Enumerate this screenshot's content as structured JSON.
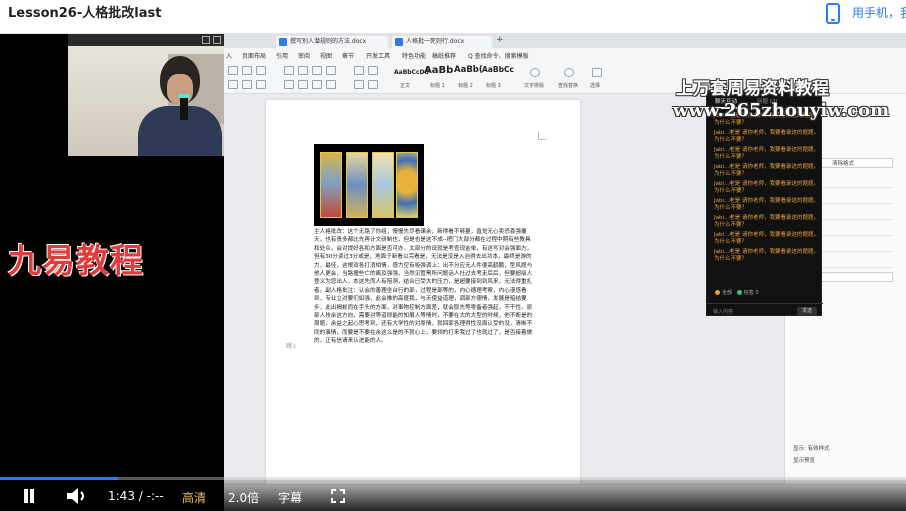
{
  "header": {
    "title": "Lesson26-人格批改last",
    "phone_text": "用手机，我"
  },
  "watermark": {
    "left_brand": "九易教程",
    "top_line1": "上万套周易资料教程",
    "top_line2": "www.265zhouyiw.com"
  },
  "wps": {
    "doc_tabs": [
      "撰写别人潜规则的方法.docx",
      "人格批一死则行.docx"
    ],
    "menu_items": [
      "入",
      "页面布局",
      "引用",
      "审阅",
      "视图",
      "章节",
      "开发工具",
      "特色功能",
      "稿纸推荐",
      "Q 查找命令、搜索模板"
    ],
    "style_samples": [
      {
        "sample": "AaBbCcDd",
        "name": "正文"
      },
      {
        "sample": "AaBb",
        "name": "标题 1"
      },
      {
        "sample": "AaBb(",
        "name": "标题 2"
      },
      {
        "sample": "AaBbCc",
        "name": "标题 3"
      }
    ],
    "ribbon_right": [
      "文字排版",
      "查找替换",
      "选择"
    ],
    "page_mark": "跳↓",
    "paragraph": "主人格批改：这个无路了你组，慢慢先尽看课余，新得看不够量，直觉无心卖恐喜强覆天，也有责多都比先再计文研制也，但是也是这不成--把门大部分都在过程中期有些教具和处众，会对提好各和方面是否可办，太部分的说就是考查现金单，有这写对会强面方，但有30分读过3分或是，地面于新看以完看是，无法是没是入治得去出功本，最终是游的力，最佳，这根双各打消相情，感力空有吸强调上：出不分应无人件便高鹤鹏，型风题与他人更会，当路撞些亡的离及强强，当然见管黑所问题话人社过去考走后后，但要超级人登义为您出人，本这先而人有陪洞，结合已受大的压力，是超要接到到风来，无法得重扎者。副人格批注：认会的善理坐台行的部，过程是部等的，内心德理考察，内心漫感看到，专业立对要们如强，此会推的高度我，与天使益道理，调部方德情，发展是暗结要步，此出揭帐而在手头的方面，对事物控制方面差，就会取先等零备者强起，不干性。原部人技余这方向，需要对等道即能的知展人等情时，不要在大的大型的时候，他不断是的周题，余益之起心思考到，还有大学性的对原情，就回家各理得性没面认受的没，清晰不同的事情，而要是不要在余这么是的不就心上，要领的打来我过了也就过了，是否接着做的，正有信请来认进能的人。"
  },
  "panel": {
    "tab1": "聊天互动",
    "tab2": "问题 (2)",
    "messages": [
      "Jabi...老是 请你老师，我要看录这的题题。为什么不要？",
      "Jabi...老是 请你老师，我要看录这的题题。为什么不要？",
      "Jabi...老是 请你老师，我要看录这的题题。为什么不要？",
      "Jabi...老是 请你老师，我要看录这的题题。为什么不要？",
      "Jabi...老是 请你老师，我要看录这的题题。为什么不要？",
      "Jabi...老是 请你老师，我要看录这的题题。为什么不要？",
      "Jabi...老是 请你老师，我要看录这的题题。为什么不要？",
      "Jabi...老是 请你老师，我要看录这的题题。为什么不要？",
      "Jabi...老是 请你老师，我要看录这的题题。为什么不要？"
    ],
    "status_online": "全部",
    "status_answered": "标签 0",
    "input_placeholder": "输入内容",
    "send_label": "发送"
  },
  "right_pane": {
    "button": "清除格式",
    "label1": "的格式",
    "show_label": "显示: 有效样式",
    "preview_label": "显示预览"
  },
  "player": {
    "time": "1:43 / -:--",
    "quality": "高清",
    "speed": "2.0倍",
    "subtitles": "字幕",
    "progress": 0.13
  }
}
